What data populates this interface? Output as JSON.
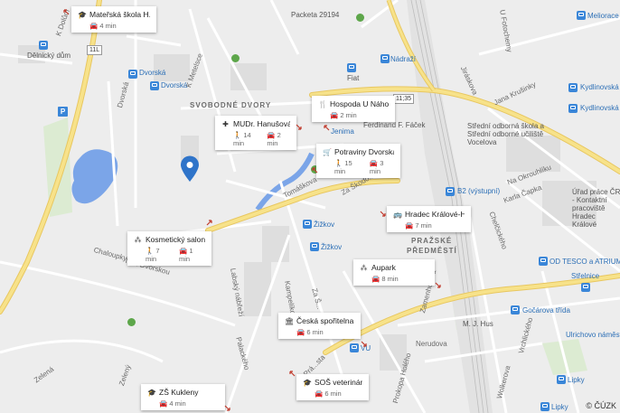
{
  "map": {
    "copyright": "© ČÚZK",
    "selected_pin": "location-pin-icon",
    "colors": {
      "background": "#ededed",
      "water": "#7ba5e8",
      "road_major": "#f7e28a",
      "pin": "#2f74c9",
      "card_bg": "#ffffff",
      "stop": "#3a86d8"
    }
  },
  "labels": {
    "svobodne_dvory": "SVOBODNÉ DVORY",
    "prazske_predmesti_1": "PRAŽSKÉ",
    "prazske_predmesti_2": "PŘEDMĚSTÍ",
    "dvorska_stop_1": "Dvorská",
    "dvorska_stop_2": "Dvorská",
    "dvorska_street": "Dvorská",
    "k_metelsce": "K Metelsce",
    "k_dolum": "K Dolům",
    "delnicky_dum": "Dělnický dům",
    "road_11l": "11L",
    "packeta": "Packeta 29194",
    "nadrazi": "Nádraží",
    "fiat": "Fiat",
    "road_11_35": "11;35",
    "jenima": "Jenima",
    "ferdinand": "Ferdinand F. Fáček",
    "tomaskova": "Tomáškova",
    "za_skodovkou": "Za Škodo...",
    "zizkov_1": "Žižkov",
    "zizkov_2": "Žižkov",
    "chaloupky": "Chaloupky",
    "nad_dvorskou": "Nad Dvorskou",
    "labsky_nabrezi": "Labský nábřeží",
    "palackeho": "Palackého",
    "kampelikova": "Kampelíkova",
    "za_skodou_2": "Za Š...",
    "zelena": "Zelená",
    "zeleny": "Zelený",
    "b2_vystup": "B2 (výstupní)",
    "stredni_skola": "Střední odborná škola a Střední odborné učiliště Vocelova",
    "jana_krusinky": "Jana Krušinky",
    "na_okrouhliku": "Na Okrouhlíku",
    "karla_capka": "Karla Čapka",
    "uradpraceCR": "Úřad práce ČR - Kontaktní pracoviště Hradec Králové",
    "chelcickeho": "Chelčického",
    "kydlinovska_1": "Kydlinovská",
    "kydlinovska_2": "Kydlinovská",
    "meliorace": "Meliorace",
    "u_fotochemy": "U Fotochemy",
    "jiraskova": "Jiráskova",
    "od_tesco": "OD TESCO a ATRIUM",
    "strelnice": "Střelnice",
    "godarova_trida": "Gočárova třída",
    "ulrichovo": "Ulrichovo náměstí",
    "m_j_hus": "M. J. Hus",
    "nerudova": "Nerudova",
    "vrchlickeho": "Vrchlického",
    "wolkerova": "Wolkerova",
    "prokopa_holeho": "Prokopa Holého",
    "zamenhofova": "Zamenhofova",
    "lipky_1": "Lipky",
    "lipky_2": "Lipky",
    "urbanova": "Urbanova",
    "zalosicova": "Žalo...",
    "pra_street": "Prá...sta",
    "zelezna": "Železná",
    "vu": "VU"
  },
  "cards": [
    {
      "name": "Mateřská škola H...",
      "icon": "school-icon",
      "icon_glyph": "🎓",
      "walk": "",
      "car": "4 min"
    },
    {
      "name": "Hospoda U Náhona",
      "icon": "restaurant-icon",
      "icon_glyph": "🍴",
      "walk": "",
      "car": "2 min"
    },
    {
      "name": "MUDr. Hanušová ...",
      "icon": "medical-icon",
      "icon_glyph": "✚",
      "walk": "14 min",
      "car": "2 min"
    },
    {
      "name": "Potraviny Dvorska",
      "icon": "shop-icon",
      "icon_glyph": "🛒",
      "walk": "15 min",
      "car": "3 min"
    },
    {
      "name": "Hradec Králové-H...",
      "icon": "bus-icon",
      "icon_glyph": "🚌",
      "walk": "",
      "car": "7 min"
    },
    {
      "name": "Kosmetický salon...",
      "icon": "salon-icon",
      "icon_glyph": "⁂",
      "walk": "7 min",
      "car": "1 min"
    },
    {
      "name": "Aupark",
      "icon": "mall-icon",
      "icon_glyph": "⁂",
      "walk": "",
      "car": "8 min"
    },
    {
      "name": "Česká spořitelna",
      "icon": "bank-icon",
      "icon_glyph": "🏛",
      "walk": "",
      "car": "6 min"
    },
    {
      "name": "SOŠ veterinární",
      "icon": "school-icon",
      "icon_glyph": "🎓",
      "walk": "",
      "car": "6 min"
    },
    {
      "name": "ZŠ Kukleny",
      "icon": "school-icon",
      "icon_glyph": "🎓",
      "walk": "",
      "car": "4 min"
    }
  ]
}
